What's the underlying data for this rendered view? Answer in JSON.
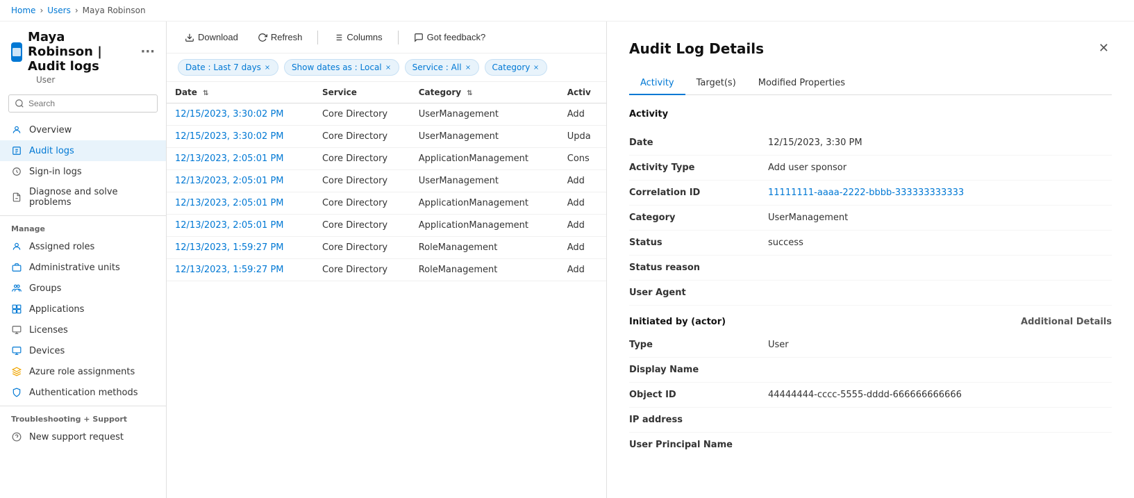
{
  "breadcrumb": {
    "items": [
      "Home",
      "Users",
      "Maya Robinson"
    ]
  },
  "page_title": "Maya Robinson | Audit logs",
  "page_subtitle": "User",
  "sidebar": {
    "search_placeholder": "Search",
    "nav_items": [
      {
        "id": "overview",
        "label": "Overview",
        "icon": "overview"
      },
      {
        "id": "audit-logs",
        "label": "Audit logs",
        "icon": "audit",
        "active": true
      },
      {
        "id": "sign-in-logs",
        "label": "Sign-in logs",
        "icon": "signin"
      },
      {
        "id": "diagnose",
        "label": "Diagnose and solve problems",
        "icon": "diagnose"
      }
    ],
    "manage_section": "Manage",
    "manage_items": [
      {
        "id": "assigned-roles",
        "label": "Assigned roles",
        "icon": "roles"
      },
      {
        "id": "admin-units",
        "label": "Administrative units",
        "icon": "admin"
      },
      {
        "id": "groups",
        "label": "Groups",
        "icon": "groups"
      },
      {
        "id": "applications",
        "label": "Applications",
        "icon": "applications"
      },
      {
        "id": "licenses",
        "label": "Licenses",
        "icon": "licenses"
      },
      {
        "id": "devices",
        "label": "Devices",
        "icon": "devices"
      },
      {
        "id": "azure-roles",
        "label": "Azure role assignments",
        "icon": "azure-roles"
      },
      {
        "id": "auth-methods",
        "label": "Authentication methods",
        "icon": "auth"
      }
    ],
    "troubleshoot_section": "Troubleshooting + Support",
    "troubleshoot_items": [
      {
        "id": "support",
        "label": "New support request",
        "icon": "support"
      }
    ]
  },
  "toolbar": {
    "download_label": "Download",
    "refresh_label": "Refresh",
    "columns_label": "Columns",
    "feedback_label": "Got feedback?"
  },
  "filters": {
    "date_filter": "Date : Last 7 days",
    "show_dates_filter": "Show dates as : Local",
    "service_filter": "Service : All",
    "category_filter": "Category"
  },
  "table": {
    "columns": [
      "Date",
      "Service",
      "Category",
      "Activ"
    ],
    "rows": [
      {
        "date": "12/15/2023, 3:30:02 PM",
        "service": "Core Directory",
        "category": "UserManagement",
        "activity": "Add"
      },
      {
        "date": "12/15/2023, 3:30:02 PM",
        "service": "Core Directory",
        "category": "UserManagement",
        "activity": "Upda"
      },
      {
        "date": "12/13/2023, 2:05:01 PM",
        "service": "Core Directory",
        "category": "ApplicationManagement",
        "activity": "Cons"
      },
      {
        "date": "12/13/2023, 2:05:01 PM",
        "service": "Core Directory",
        "category": "UserManagement",
        "activity": "Add"
      },
      {
        "date": "12/13/2023, 2:05:01 PM",
        "service": "Core Directory",
        "category": "ApplicationManagement",
        "activity": "Add"
      },
      {
        "date": "12/13/2023, 2:05:01 PM",
        "service": "Core Directory",
        "category": "ApplicationManagement",
        "activity": "Add"
      },
      {
        "date": "12/13/2023, 1:59:27 PM",
        "service": "Core Directory",
        "category": "RoleManagement",
        "activity": "Add"
      },
      {
        "date": "12/13/2023, 1:59:27 PM",
        "service": "Core Directory",
        "category": "RoleManagement",
        "activity": "Add"
      }
    ]
  },
  "detail_panel": {
    "title": "Audit Log Details",
    "tabs": [
      "Activity",
      "Target(s)",
      "Modified Properties"
    ],
    "active_tab": "Activity",
    "activity_section_title": "Activity",
    "fields": [
      {
        "label": "Date",
        "value": "12/15/2023, 3:30 PM",
        "is_link": false
      },
      {
        "label": "Activity Type",
        "value": "Add user sponsor",
        "is_link": false
      },
      {
        "label": "Correlation ID",
        "value": "11111111-aaaa-2222-bbbb-333333333333",
        "is_link": true
      },
      {
        "label": "Category",
        "value": "UserManagement",
        "is_link": false
      },
      {
        "label": "Status",
        "value": "success",
        "is_link": false
      },
      {
        "label": "Status reason",
        "value": "",
        "is_link": false
      },
      {
        "label": "User Agent",
        "value": "",
        "is_link": false
      }
    ],
    "initiated_by_section": "Initiated by (actor)",
    "additional_details_link": "Additional Details",
    "actor_fields": [
      {
        "label": "Type",
        "value": "User",
        "is_link": false
      },
      {
        "label": "Display Name",
        "value": "",
        "is_link": false
      },
      {
        "label": "Object ID",
        "value": "44444444-cccc-5555-dddd-666666666666",
        "is_link": false
      },
      {
        "label": "IP address",
        "value": "",
        "is_link": false
      },
      {
        "label": "User Principal Name",
        "value": "",
        "is_link": false
      }
    ]
  }
}
